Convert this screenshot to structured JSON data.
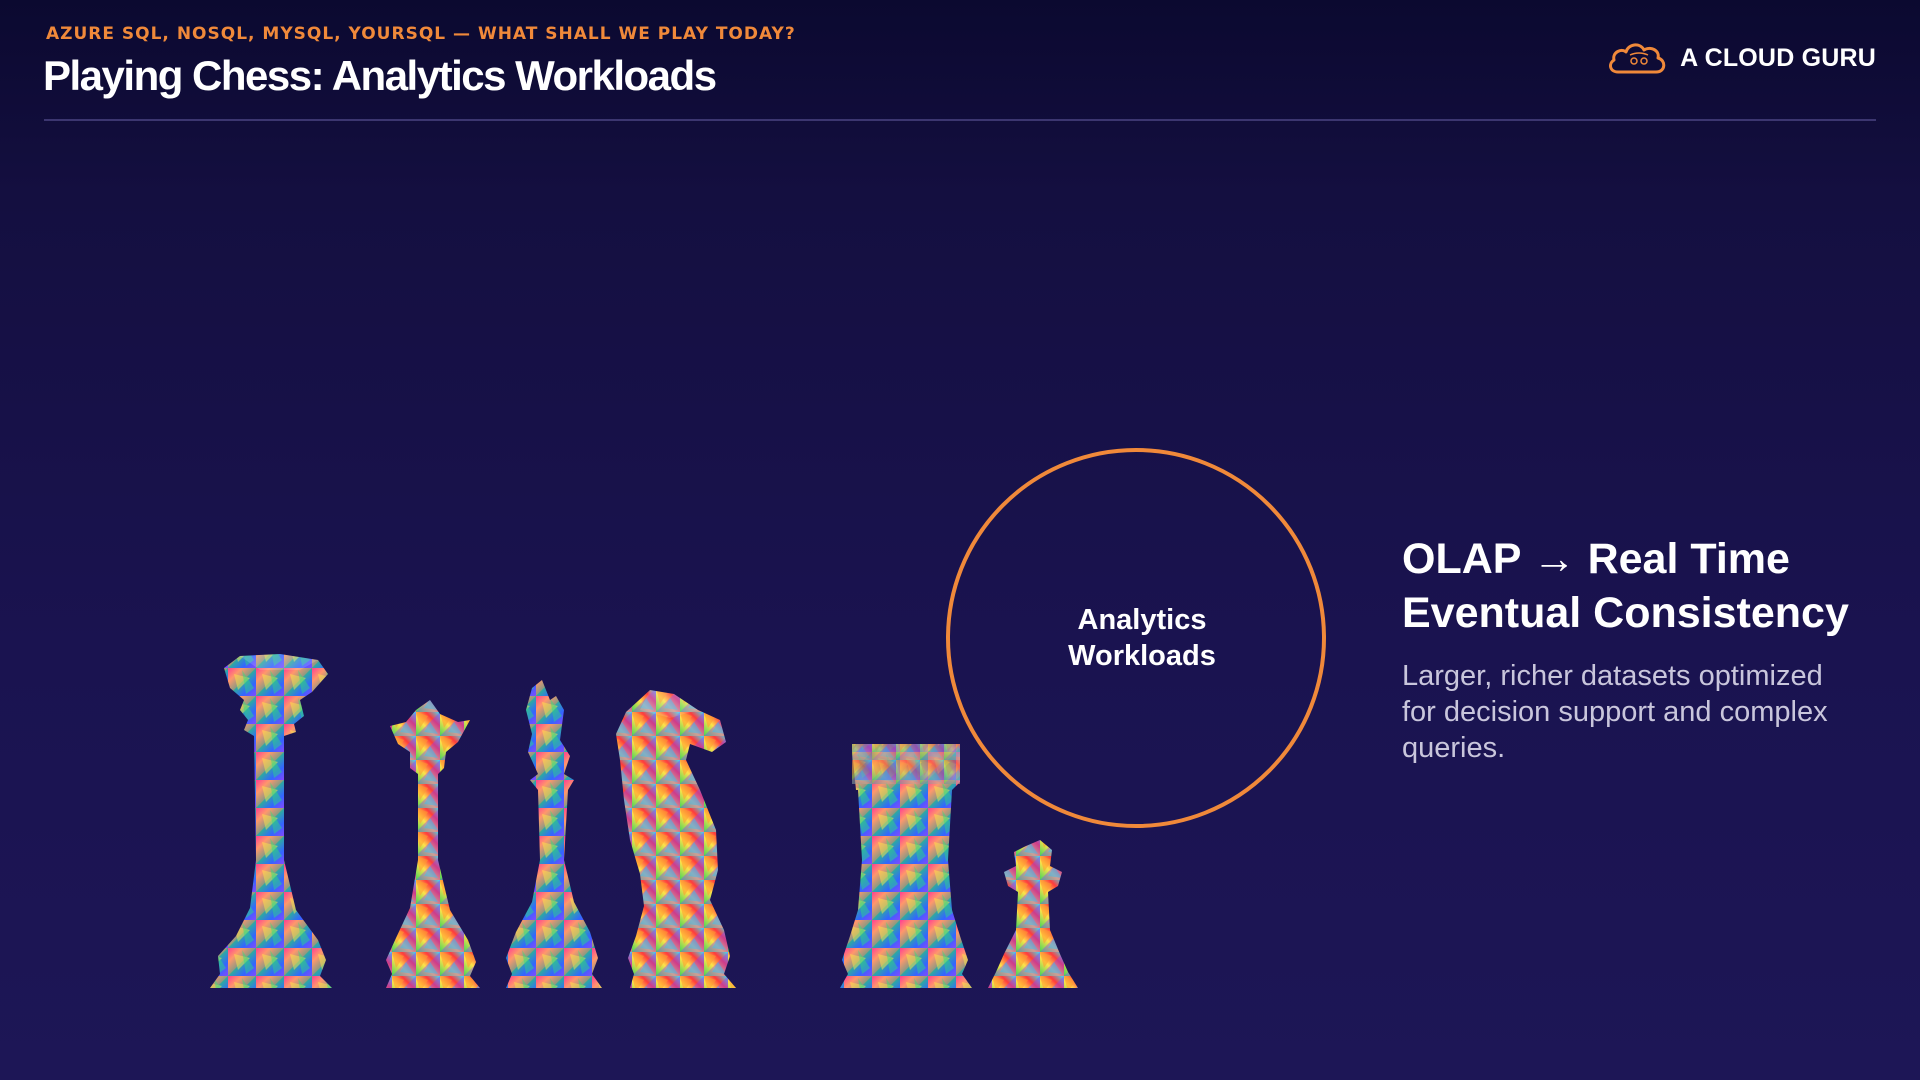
{
  "header": {
    "kicker": "AZURE SQL, NOSQL, MYSQL, YOURSQL — WHAT SHALL WE PLAY TODAY?",
    "title": "Playing Chess: Analytics Workloads"
  },
  "brand": {
    "logo_icon": "cloud-logo-icon",
    "name": "A CLOUD GURU"
  },
  "illustration": {
    "pieces": [
      "king",
      "queen",
      "bishop",
      "knight",
      "rook",
      "pawn"
    ]
  },
  "circle": {
    "label_line1": "Analytics",
    "label_line2": "Workloads"
  },
  "content": {
    "heading_line1": "OLAP → Real Time",
    "heading_line2": "Eventual Consistency",
    "description": "Larger, richer datasets optimized for decision support and complex queries."
  },
  "colors": {
    "accent": "#f0893a",
    "background": "#1a1350",
    "text": "#ffffff",
    "muted_text": "#c9c6dc"
  }
}
